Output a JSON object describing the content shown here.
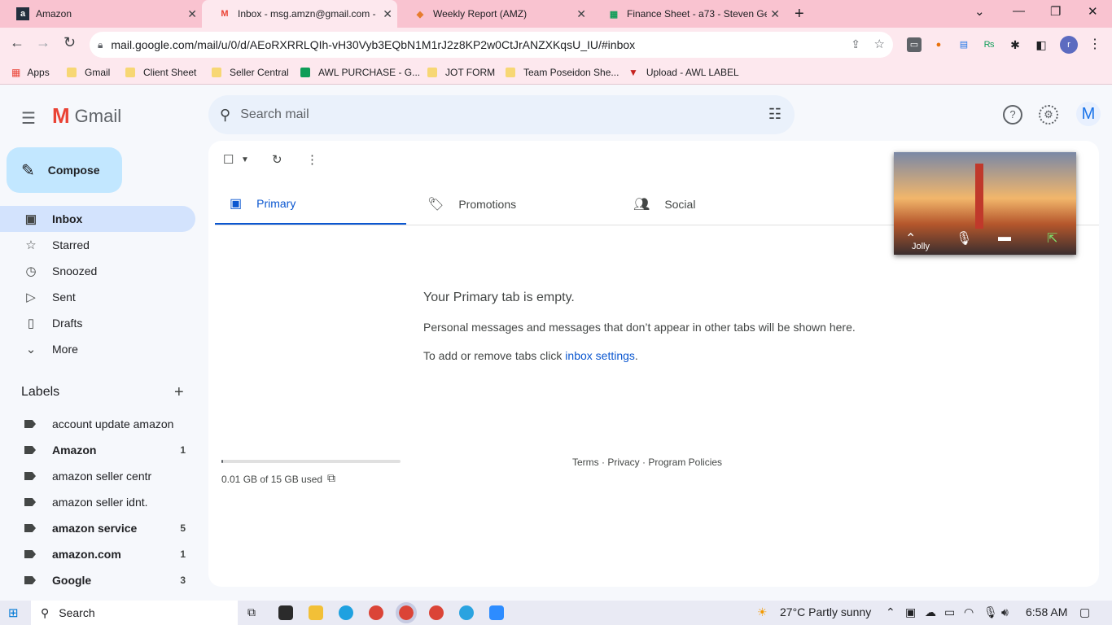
{
  "browser": {
    "tabs": [
      {
        "title": "Amazon",
        "favicon": "a",
        "favicon_color": "#232f3e"
      },
      {
        "title": "Inbox - msg.amzn@gmail.com -",
        "favicon": "M",
        "favicon_color": "#ea4335"
      },
      {
        "title": "Weekly Report (AMZ)",
        "favicon": "◆",
        "favicon_color": "#e67c2e"
      },
      {
        "title": "Finance Sheet - a73 - Steven Ge",
        "favicon": "▦",
        "favicon_color": "#0f9d58"
      }
    ],
    "url": "mail.google.com/mail/u/0/d/AEoRXRRLQIh-vH30Vyb3EQbN1M1rJ2z8KP2w0CtJrANZXKqsU_IU/#inbox",
    "bookmarks": [
      "Apps",
      "Gmail",
      "Client Sheet",
      "Seller Central",
      "AWL PURCHASE - G...",
      "JOT FORM",
      "Team Poseidon She...",
      "Upload - AWL LABEL"
    ]
  },
  "gmail": {
    "app_name": "Gmail",
    "search_placeholder": "Search mail",
    "avatar_letter": "M",
    "compose_label": "Compose",
    "nav": [
      {
        "label": "Inbox",
        "icon": "inbox-icon",
        "glyph": "▣"
      },
      {
        "label": "Starred",
        "icon": "star-icon",
        "glyph": "☆"
      },
      {
        "label": "Snoozed",
        "icon": "clock-icon",
        "glyph": "◷"
      },
      {
        "label": "Sent",
        "icon": "send-icon",
        "glyph": "▷"
      },
      {
        "label": "Drafts",
        "icon": "draft-icon",
        "glyph": "▯"
      },
      {
        "label": "More",
        "icon": "chevron-down-icon",
        "glyph": "⌄"
      }
    ],
    "labels_title": "Labels",
    "labels": [
      {
        "name": "account update amazon",
        "count": "",
        "bold": false
      },
      {
        "name": "Amazon",
        "count": "1",
        "bold": true
      },
      {
        "name": "amazon seller centr",
        "count": "",
        "bold": false
      },
      {
        "name": "amazon seller idnt.",
        "count": "",
        "bold": false
      },
      {
        "name": "amazon service",
        "count": "5",
        "bold": true
      },
      {
        "name": "amazon.com",
        "count": "1",
        "bold": true
      },
      {
        "name": "Google",
        "count": "3",
        "bold": true
      }
    ],
    "category_tabs": [
      "Primary",
      "Promotions",
      "Social"
    ],
    "empty_title": "Your Primary tab is empty.",
    "empty_desc": "Personal messages and messages that don’t appear in other tabs will be shown here.",
    "empty_settings_prefix": "To add or remove tabs click ",
    "empty_settings_link": "inbox settings",
    "empty_settings_suffix": ".",
    "storage_text": "0.01 GB of 15 GB used",
    "storage_fraction": 0.001,
    "footer": "Terms · Privacy · Program Policies",
    "pip_name": "Jolly"
  },
  "taskbar": {
    "search_label": "Search",
    "weather": "27°C  Partly sunny",
    "time": "6:58 AM"
  }
}
